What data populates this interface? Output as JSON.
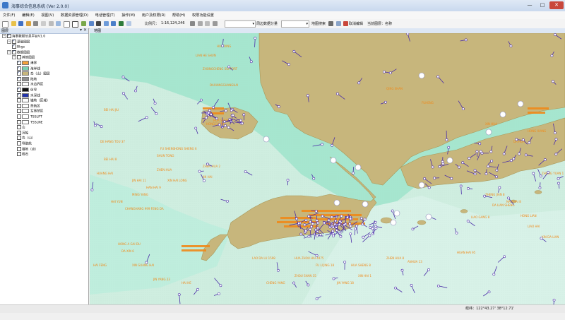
{
  "window": {
    "title": "海事综合信息系统 (Ver 2.0.0)",
    "minimize": "—",
    "maximize": "□",
    "close": "✕"
  },
  "menu": [
    "文件(F)",
    "编辑(E)",
    "视图(V)",
    "数据资源管理(D)",
    "电话管理(T)",
    "操作(M)",
    "用户及权限(R)",
    "帮助(H)",
    "权限功能设置"
  ],
  "toolbar": {
    "scale_label": "比例尺：",
    "scale_value": "1:16,124,246",
    "dropdown_1": "",
    "measure_label": "周边数据分量",
    "dropdown_2": "",
    "map_search": "地图搜索",
    "cancel_edit": "取消编辑",
    "current_layer": "当前图层：名称"
  },
  "colors": {
    "sea": "#cfeee0",
    "shallow_sea": "#a6e6cf",
    "land": "#c7b67c",
    "vessel": "#4b2ea8",
    "label": "#f08a1a"
  },
  "layers_panel": {
    "title": "图层",
    "items": [
      {
        "label": "海事数据信息平台V1.0",
        "indent": 0,
        "checked": true,
        "expander": "−",
        "swatch": null
      },
      {
        "label": "基础图层",
        "indent": 1,
        "checked": true,
        "expander": "−",
        "swatch": null
      },
      {
        "label": "Bkgs",
        "indent": 2,
        "checked": true,
        "expander": null,
        "swatch": null
      },
      {
        "label": "数据图层",
        "indent": 1,
        "checked": true,
        "expander": "−",
        "swatch": null
      },
      {
        "label": "其他图层",
        "indent": 2,
        "checked": false,
        "expander": "−",
        "swatch": null
      },
      {
        "label": "港界",
        "indent": 3,
        "checked": true,
        "expander": null,
        "swatch": "#f5a23c"
      },
      {
        "label": "海岸线",
        "indent": 3,
        "checked": true,
        "expander": null,
        "swatch": "#7bd1b2"
      },
      {
        "label": "岛（山）图层",
        "indent": 3,
        "checked": true,
        "expander": null,
        "swatch": "#c7b67c"
      },
      {
        "label": "陆地",
        "indent": 3,
        "checked": true,
        "expander": null,
        "swatch": "#8f8f8f"
      },
      {
        "label": "水边界区",
        "indent": 3,
        "checked": false,
        "expander": null,
        "swatch": "#ffffff"
      },
      {
        "label": "信号",
        "indent": 3,
        "checked": true,
        "expander": null,
        "swatch": "#111111"
      },
      {
        "label": "水深线",
        "indent": 3,
        "checked": true,
        "expander": null,
        "swatch": "#2233aa"
      },
      {
        "label": "锚地（区域）",
        "indent": 3,
        "checked": false,
        "expander": null,
        "swatch": "#ffffff"
      },
      {
        "label": "禁航区",
        "indent": 3,
        "checked": false,
        "expander": null,
        "swatch": "#ffffff"
      },
      {
        "label": "军事禁区",
        "indent": 3,
        "checked": false,
        "expander": null,
        "swatch": "#ffffff"
      },
      {
        "label": "TSSLPT",
        "indent": 3,
        "checked": false,
        "expander": null,
        "swatch": "#ffffff"
      },
      {
        "label": "TSSLNE",
        "indent": 3,
        "checked": false,
        "expander": null,
        "swatch": "#ffffff"
      },
      {
        "label": "山",
        "indent": 3,
        "checked": false,
        "expander": null,
        "swatch": null
      },
      {
        "label": "沉船",
        "indent": 3,
        "checked": false,
        "expander": null,
        "swatch": null
      },
      {
        "label": "岛（山）",
        "indent": 3,
        "checked": false,
        "expander": null,
        "swatch": null
      },
      {
        "label": "导助航",
        "indent": 3,
        "checked": false,
        "expander": null,
        "swatch": null
      },
      {
        "label": "锚地（点）",
        "indent": 3,
        "checked": false,
        "expander": null,
        "swatch": null
      },
      {
        "label": "岩石",
        "indent": 3,
        "checked": false,
        "expander": null,
        "swatch": null
      }
    ]
  },
  "map": {
    "tab": "地图",
    "ship_labels": [
      "HUA DING",
      "LIAN HE SHUN",
      "ZHONGCHENG SUPPORT",
      "DAXIANGGUANGHAI",
      "JIN HAI 11",
      "BEI HAI JIU",
      "FU SHENG",
      "DE HANG TOU 37",
      "HAN HAI 9",
      "HONG SHENG 6",
      "ZHEN HUA",
      "SHUN TONG",
      "HONGCHANG",
      "HUA SHENG",
      "XIN HAI LONG",
      "MING YANG",
      "HAI YUN",
      "CHANGHANG 999 FENG DA",
      "ZHEN HUA 2",
      "JIN HAI",
      "QING SHAN",
      "FUHENG",
      "XIN HUA",
      "DA HUA",
      "HONG XIANG",
      "HONG A GAI DU",
      "DA XIN 6",
      "XIN GUANG HAI",
      "JIN YANG 23",
      "HAI HE",
      "HAI FENG",
      "LAO DA LU 1598",
      "HUA ZHOU HAI 4475",
      "FU LI JING 18",
      "HUA SHENG 8",
      "XIN HAI 1",
      "ZHOU SHAN 35",
      "CHENG YANG",
      "JIN YANG 18",
      "ZHEN HUA 8",
      "ANHUA 13",
      "HUAN HAI 95",
      "ZHENG JIAN 8",
      "NAN HAI 8",
      "HONG LIAN",
      "LIAO HAI",
      "XIN DA LIAN",
      "ZHONG YUAN 1",
      "HUANG HAI",
      "BEI HAI 8",
      "LIAO GANG 8",
      "DA LIAN SHENG"
    ]
  },
  "status": {
    "coordinates": "经纬：122°43.27' 38°12.71'"
  }
}
